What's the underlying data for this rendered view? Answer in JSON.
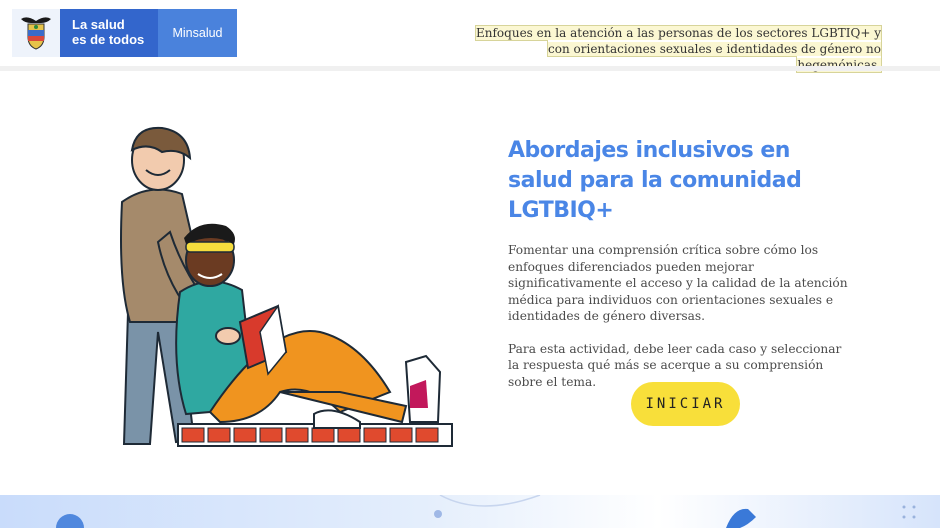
{
  "header": {
    "brand_line1": "La salud",
    "brand_line2": "es de todos",
    "brand_sub": "Minsalud",
    "title": "Enfoques en la atención a las personas de los sectores LGBTIQ+ y con orientaciones sexuales e identidades de género no hegemónicas."
  },
  "main": {
    "heading": "Abordajes inclusivos en salud para la comunidad LGTBIQ+",
    "paragraph1": "Fomentar una comprensión crítica sobre cómo los enfoques diferenciados pueden mejorar significativamente el acceso y la calidad de la atención médica para individuos con orientaciones sexuales e identidades de género diversas.",
    "paragraph2": "Para esta actividad, debe leer cada caso y seleccionar la respuesta qué más se acerque a su comprensión sobre el tema.",
    "start_label": "INICIAR"
  },
  "icons": {
    "seal": "colombia-coat-of-arms-icon",
    "illustration": "two-people-reading-illustration"
  },
  "colors": {
    "brand_blue": "#3366cc",
    "brand_blue_light": "#4a82dc",
    "heading_blue": "#4a86e6",
    "button_yellow": "#f8df3a"
  }
}
